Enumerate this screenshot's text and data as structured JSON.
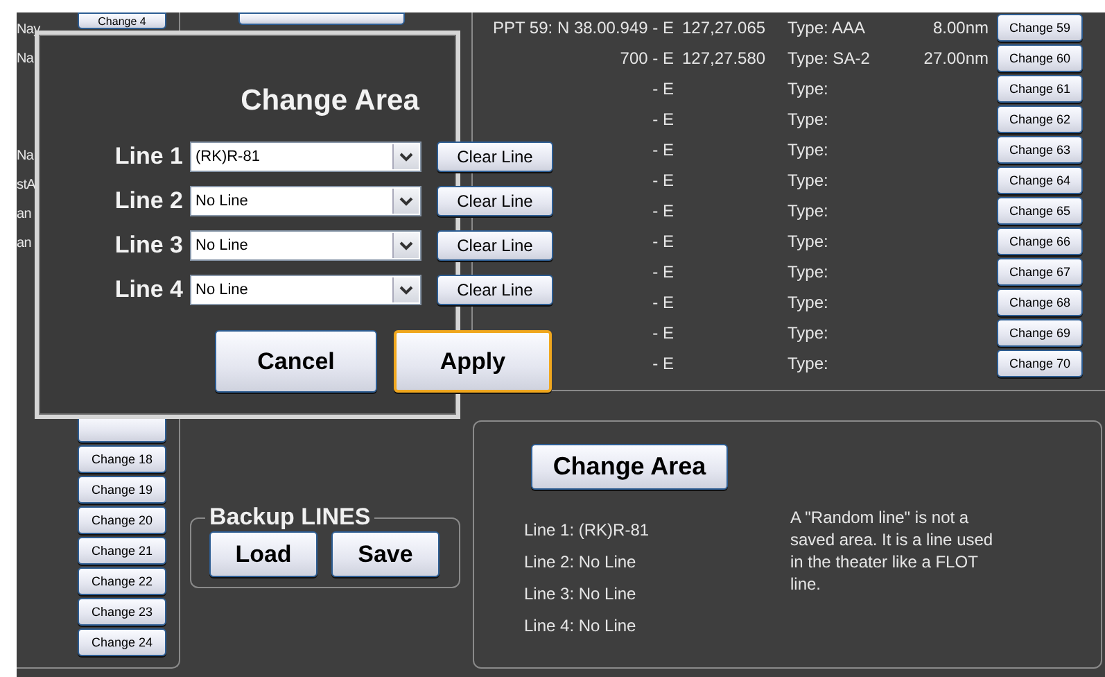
{
  "left_panel": {
    "labels": [
      "Nay",
      "Na",
      "Na",
      "stA",
      "an",
      "an"
    ],
    "top_button": "Change 4",
    "buttons": [
      "Change 18",
      "Change 19",
      "Change 20",
      "Change 21",
      "Change 22",
      "Change 23",
      "Change 24"
    ]
  },
  "backup": {
    "title": "Backup LINES",
    "buttons": [
      "Load",
      "Save"
    ]
  },
  "points": [
    {
      "west": "PPT 59: N  38.00.949 - E",
      "east": "127,27.065",
      "type": "Type: AAA",
      "distance": "8.00nm",
      "button": "Change 59"
    },
    {
      "west": "700 - E",
      "east": "127,27.580",
      "type": "Type: SA-2",
      "distance": "27.00nm",
      "button": "Change 60"
    },
    {
      "west": "- E",
      "type": "Type:",
      "button": "Change 61"
    },
    {
      "west": "- E",
      "type": "Type:",
      "button": "Change 62"
    },
    {
      "west": "- E",
      "type": "Type:",
      "button": "Change 63"
    },
    {
      "west": "- E",
      "type": "Type:",
      "button": "Change 64"
    },
    {
      "west": "- E",
      "type": "Type:",
      "button": "Change 65"
    },
    {
      "west": "- E",
      "type": "Type:",
      "button": "Change 66"
    },
    {
      "west": "- E",
      "type": "Type:",
      "button": "Change 67"
    },
    {
      "west": "- E",
      "type": "Type:",
      "button": "Change 68"
    },
    {
      "west": "- E",
      "type": "Type:",
      "button": "Change 69"
    },
    {
      "west": "- E",
      "type": "Type:",
      "button": "Change 70"
    }
  ],
  "lines_panel": {
    "button": "Change Area",
    "lines": [
      "Line 1: (RK)R-81",
      "Line 2: No Line",
      "Line 3: No Line",
      "Line 4: No Line"
    ],
    "note": "A \"Random line\" is not a saved area. It is a line used in the theater like a FLOT line."
  },
  "dialog": {
    "title": "Change Area",
    "rows": [
      {
        "label": "Line 1",
        "value": "(RK)R-81",
        "clear": "Clear Line"
      },
      {
        "label": "Line 2",
        "value": "No Line",
        "clear": "Clear Line"
      },
      {
        "label": "Line 3",
        "value": "No Line",
        "clear": "Clear Line"
      },
      {
        "label": "Line 4",
        "value": "No Line",
        "clear": "Clear Line"
      }
    ],
    "buttons": [
      {
        "label": "Cancel",
        "default": false
      },
      {
        "label": "Apply",
        "default": true
      }
    ]
  }
}
